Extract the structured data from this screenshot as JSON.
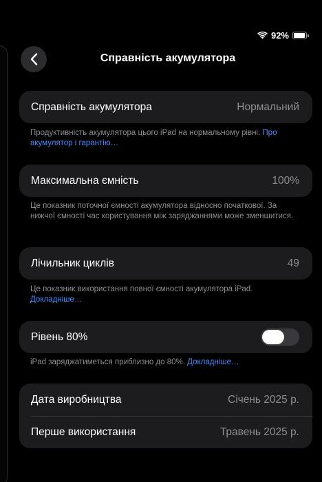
{
  "status": {
    "battery_percent": "92%",
    "battery_level": 0.92
  },
  "nav": {
    "title": "Справність акумулятора"
  },
  "health": {
    "label": "Справність акумулятора",
    "value": "Нормальний",
    "footnote_text": "Продуктивність акумулятора цього iPad на нормальному рівні.",
    "footnote_link": "Про акумулятор і гарантію…"
  },
  "capacity": {
    "label": "Максимальна ємність",
    "value": "100%",
    "footnote_text": "Це показник поточної ємності акумулятора відносно початкової. За нижчої ємності час користування між заряджаннями може зменшитися."
  },
  "cycles": {
    "label": "Лічильник циклів",
    "value": "49",
    "footnote_text": "Це показник використання повної ємності акумулятора iPad.",
    "footnote_link": "Докладніше…"
  },
  "limit": {
    "label": "Рівень 80%",
    "toggle_on": false,
    "footnote_text": "iPad заряджатиметься приблизно до 80%.",
    "footnote_link": "Докладніше…"
  },
  "dates": {
    "manufacture_label": "Дата виробництва",
    "manufacture_value": "Січень 2025 р.",
    "first_use_label": "Перше використання",
    "first_use_value": "Травень 2025 р."
  }
}
